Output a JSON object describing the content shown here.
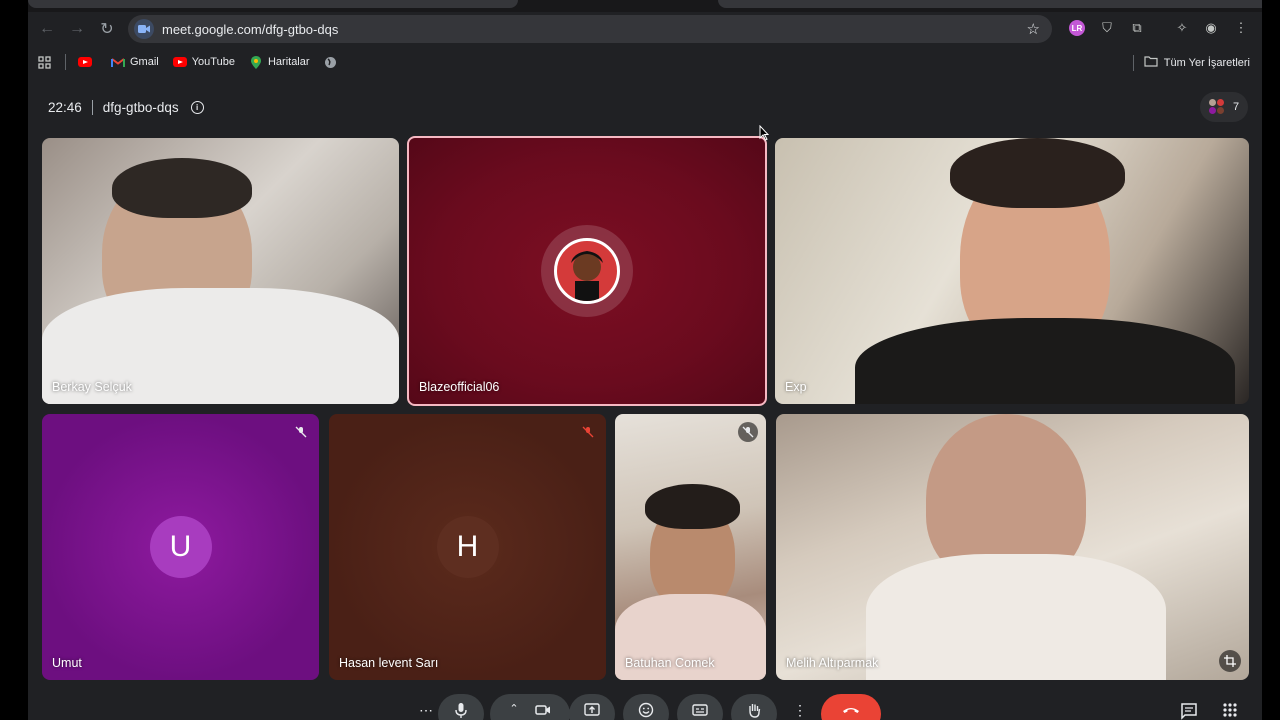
{
  "browser": {
    "url": "meet.google.com/dfg-gtbo-dqs",
    "bookmarks": [
      {
        "label": "Gmail",
        "icon": "gmail-icon"
      },
      {
        "label": "YouTube",
        "icon": "youtube-icon"
      },
      {
        "label": "Haritalar",
        "icon": "maps-pin-icon"
      }
    ],
    "all_bookmarks_label": "Tüm Yer İşaretleri",
    "profile_initials": "LR"
  },
  "meeting": {
    "time": "22:46",
    "code": "dfg-gtbo-dqs",
    "participant_count": "7"
  },
  "participants": [
    {
      "name": "Berkay Selçuk"
    },
    {
      "name": "Blazeofficial06"
    },
    {
      "name": "Exp"
    },
    {
      "name": "Umut",
      "initial": "U"
    },
    {
      "name": "Hasan levent Sarı",
      "initial": "H"
    },
    {
      "name": "Batuhan Comek"
    },
    {
      "name": "Melih Altıparmak"
    }
  ],
  "colors": {
    "end_call": "#ea4335",
    "speaker_border": "#f6b8c2",
    "umut_avatar": "#a83cbf",
    "hasan_avatar": "#5e2e20"
  }
}
